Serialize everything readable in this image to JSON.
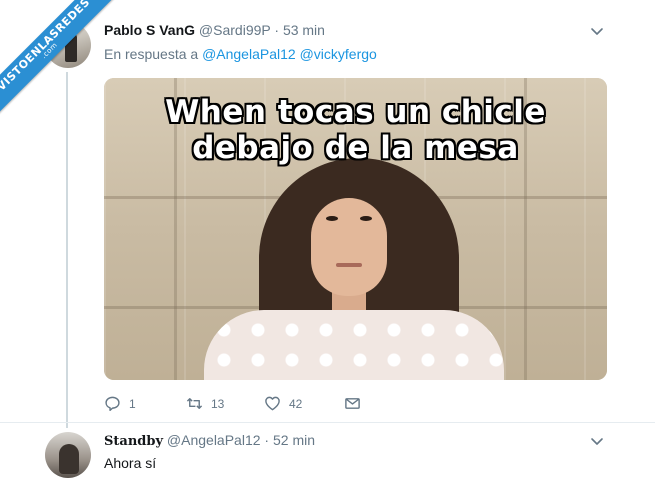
{
  "watermark": {
    "main": "VISTOENLASREDES",
    "sub": ".com",
    "color": "#2b8fd3"
  },
  "tweet": {
    "name": "Pablo S VanG",
    "handle": "@Sardi99P",
    "separator": "·",
    "time": "53 min",
    "reply_prefix": "En respuesta a",
    "reply_mentions": [
      "@AngelaPal12",
      "@vickyfergo"
    ],
    "media_caption_line1": "When tocas un chicle",
    "media_caption_line2": "debajo de la mesa",
    "actions": {
      "reply_icon": "reply-icon",
      "reply_count": "1",
      "retweet_icon": "retweet-icon",
      "retweet_count": "13",
      "like_icon": "heart-icon",
      "like_count": "42",
      "dm_icon": "envelope-icon"
    },
    "menu_icon": "chevron-down-icon"
  },
  "reply": {
    "name": "Standby",
    "handle": "@AngelaPal12",
    "separator": "·",
    "time": "52 min",
    "text": "Ahora sí",
    "menu_icon": "chevron-down-icon"
  },
  "colors": {
    "link": "#1b95e0",
    "muted": "#657786",
    "thread_line": "#cfd9de"
  }
}
